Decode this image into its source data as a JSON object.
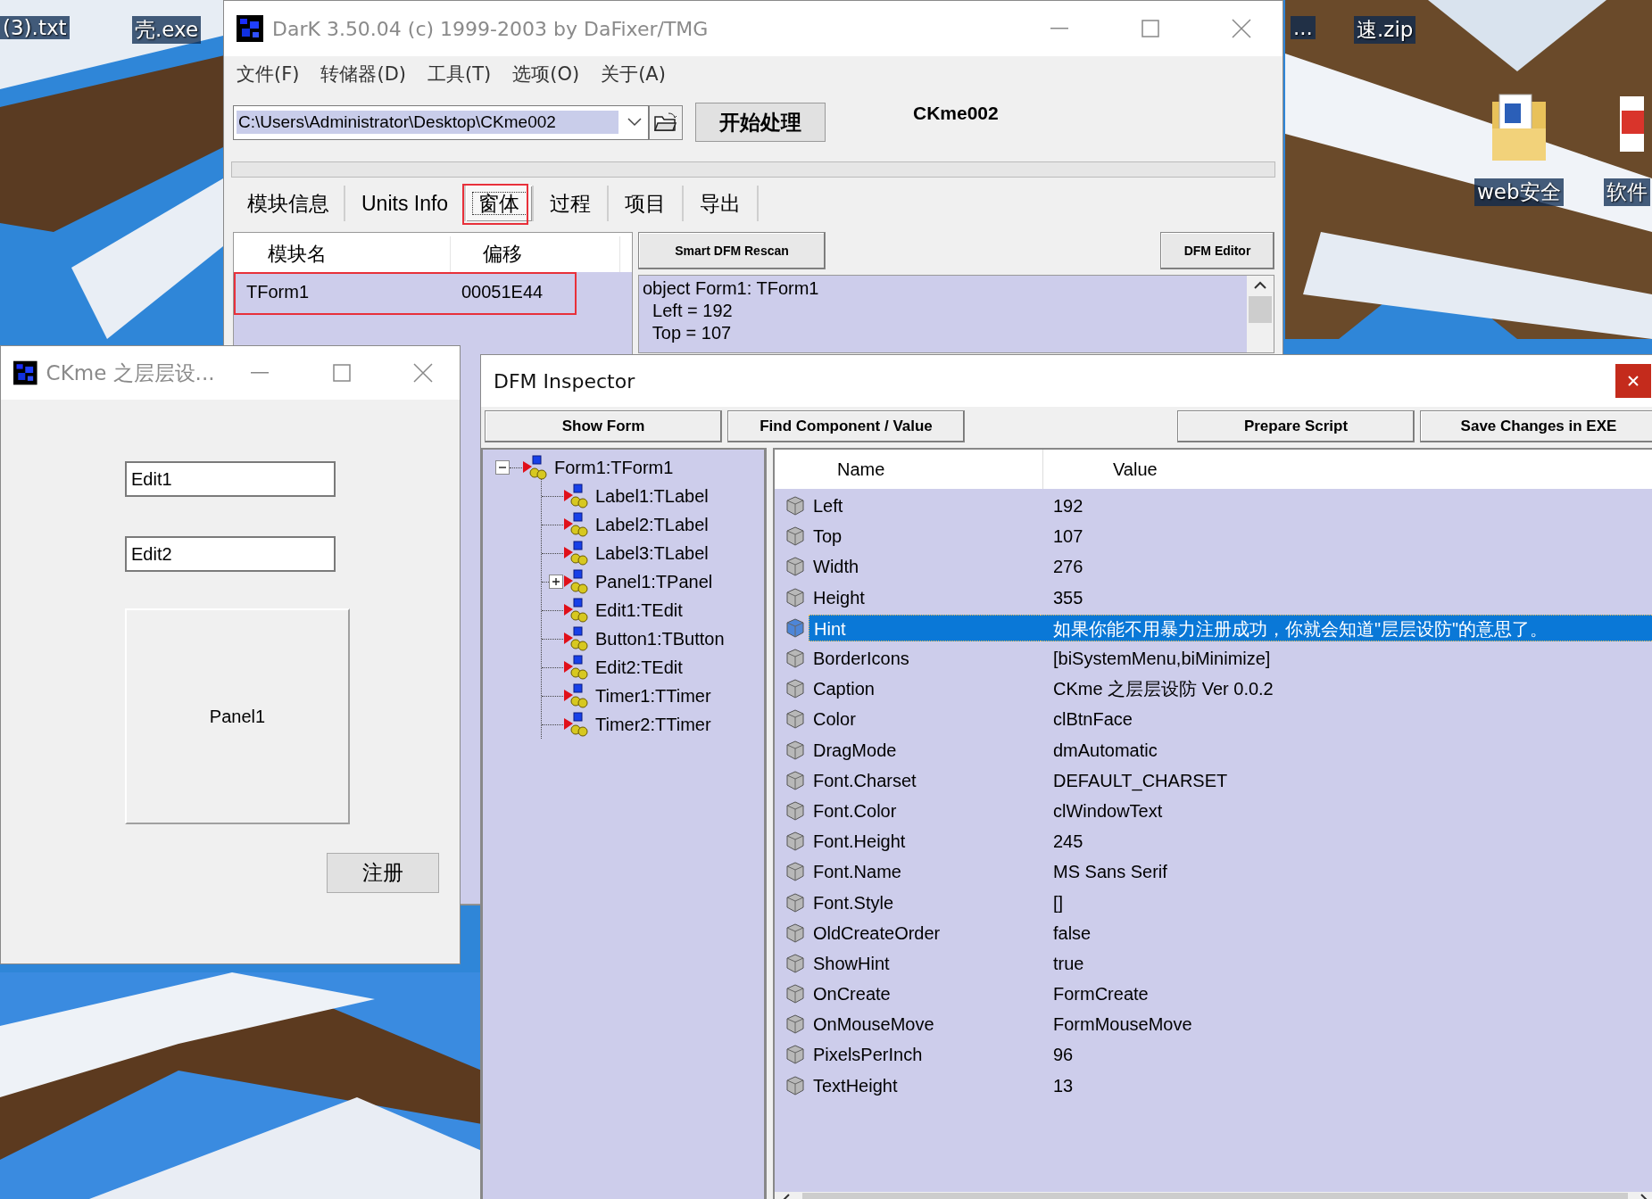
{
  "desktop": {
    "icons": [
      {
        "label": "(3).txt",
        "kind": "text"
      },
      {
        "label": "壳.exe",
        "kind": "text"
      },
      {
        "label": "...",
        "kind": "text"
      },
      {
        "label": "速.zip",
        "kind": "text"
      },
      {
        "label": "web安全",
        "kind": "folder"
      },
      {
        "label": "软件",
        "kind": "app"
      }
    ]
  },
  "dark_window": {
    "title": "DarK 3.50.04 (c) 1999-2003 by DaFixer/TMG",
    "active": false,
    "menu": [
      "文件(F)",
      "转储器(D)",
      "工具(T)",
      "选项(O)",
      "关于(A)"
    ],
    "progress": {
      "level": 0
    },
    "path": "C:\\Users\\Administrator\\Desktop\\CKme002",
    "start_button": "开始处理",
    "file_label": "CKme002",
    "tabs": [
      {
        "label": "模块信息",
        "selected": false,
        "annotated": false
      },
      {
        "label": "Units Info",
        "selected": false,
        "annotated": false
      },
      {
        "label": "窗体",
        "selected": true,
        "annotated": true
      },
      {
        "label": "过程",
        "selected": false,
        "annotated": false
      },
      {
        "label": "项目",
        "selected": false,
        "annotated": false
      },
      {
        "label": "导出",
        "selected": false,
        "annotated": false
      }
    ],
    "modules": {
      "columns": [
        "模块名",
        "偏移"
      ],
      "rows": [
        {
          "cells": [
            "TForm1",
            "00051E44"
          ],
          "annotated": true
        }
      ]
    },
    "buttons": [
      "Smart DFM Rescan",
      "DFM Editor"
    ],
    "dfm_text": [
      "object Form1: TForm1",
      "  Left = 192",
      "  Top = 107"
    ]
  },
  "ckme_window": {
    "title": "CKme 之层层设...",
    "active": false,
    "fields": [
      {
        "value": "Edit1"
      },
      {
        "value": "Edit2"
      }
    ],
    "panel": "Panel1",
    "button": "注册"
  },
  "dfm_inspector": {
    "title": "DFM Inspector",
    "buttons_left": [
      "Show Form",
      "Find Component / Value"
    ],
    "buttons_right": [
      "Prepare Script",
      "Save Changes in EXE"
    ],
    "tree": [
      {
        "label": "Form1:TForm1",
        "expanded": true,
        "children": [
          {
            "label": "Label1:TLabel"
          },
          {
            "label": "Label2:TLabel"
          },
          {
            "label": "Label3:TLabel"
          },
          {
            "label": "Panel1:TPanel",
            "expanded": false
          },
          {
            "label": "Edit1:TEdit"
          },
          {
            "label": "Button1:TButton"
          },
          {
            "label": "Edit2:TEdit"
          },
          {
            "label": "Timer1:TTimer"
          },
          {
            "label": "Timer2:TTimer"
          }
        ]
      }
    ],
    "columns": [
      "Name",
      "Value"
    ],
    "rows": [
      {
        "name": "Left",
        "value": "192",
        "selected": false
      },
      {
        "name": "Top",
        "value": "107",
        "selected": false
      },
      {
        "name": "Width",
        "value": "276",
        "selected": false
      },
      {
        "name": "Height",
        "value": "355",
        "selected": false
      },
      {
        "name": "Hint",
        "value": "如果你能不用暴力注册成功，你就会知道\"层层设防\"的意思了。",
        "selected": true
      },
      {
        "name": "BorderIcons",
        "value": "[biSystemMenu,biMinimize]",
        "selected": false
      },
      {
        "name": "Caption",
        "value": "CKme 之层层设防  Ver 0.0.2",
        "selected": false
      },
      {
        "name": "Color",
        "value": "clBtnFace",
        "selected": false
      },
      {
        "name": "DragMode",
        "value": "dmAutomatic",
        "selected": false
      },
      {
        "name": "Font.Charset",
        "value": "DEFAULT_CHARSET",
        "selected": false
      },
      {
        "name": "Font.Color",
        "value": "clWindowText",
        "selected": false
      },
      {
        "name": "Font.Height",
        "value": "245",
        "selected": false
      },
      {
        "name": "Font.Name",
        "value": "MS Sans Serif",
        "selected": false
      },
      {
        "name": "Font.Style",
        "value": "[]",
        "selected": false
      },
      {
        "name": "OldCreateOrder",
        "value": "false",
        "selected": false
      },
      {
        "name": "ShowHint",
        "value": "true",
        "selected": false
      },
      {
        "name": "OnCreate",
        "value": "FormCreate",
        "selected": false
      },
      {
        "name": "OnMouseMove",
        "value": "FormMouseMove",
        "selected": false
      },
      {
        "name": "PixelsPerInch",
        "value": "96",
        "selected": false
      },
      {
        "name": "TextHeight",
        "value": "13",
        "selected": false
      }
    ]
  }
}
